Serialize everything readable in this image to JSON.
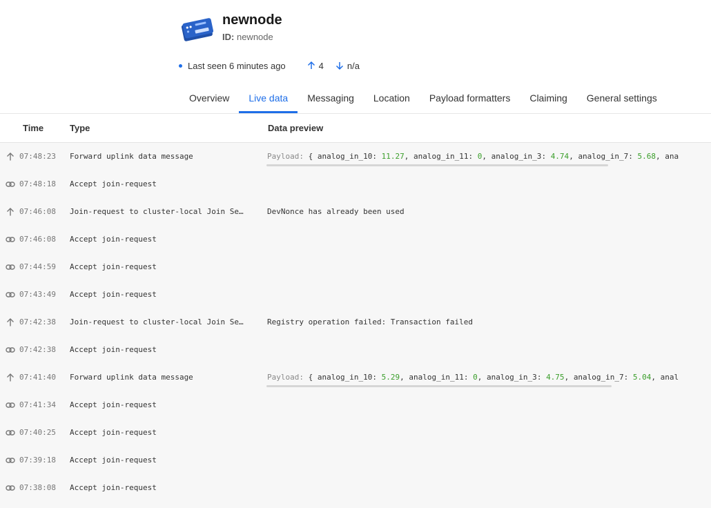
{
  "device": {
    "name": "newnode",
    "id_label": "ID:",
    "id_value": "newnode",
    "last_seen": "Last seen 6 minutes ago",
    "uplink_count": "4",
    "downlink_count": "n/a"
  },
  "tabs": [
    {
      "label": "Overview",
      "active": false
    },
    {
      "label": "Live data",
      "active": true
    },
    {
      "label": "Messaging",
      "active": false
    },
    {
      "label": "Location",
      "active": false
    },
    {
      "label": "Payload formatters",
      "active": false
    },
    {
      "label": "Claiming",
      "active": false
    },
    {
      "label": "General settings",
      "active": false
    }
  ],
  "table": {
    "headers": {
      "time": "Time",
      "type": "Type",
      "preview": "Data preview"
    },
    "rows": [
      {
        "icon": "uplink-arrow-icon",
        "time": "07:48:23",
        "type": "Forward uplink data message",
        "preview_kind": "payload",
        "payload": [
          [
            "analog_in_10",
            "11.27"
          ],
          [
            "analog_in_11",
            "0"
          ],
          [
            "analog_in_3",
            "4.74"
          ],
          [
            "analog_in_7",
            "5.68"
          ],
          [
            "ana",
            ""
          ]
        ]
      },
      {
        "icon": "link-icon",
        "time": "07:48:18",
        "type": "Accept join-request",
        "preview_kind": "none"
      },
      {
        "icon": "uplink-arrow-icon",
        "time": "07:46:08",
        "type": "Join-request to cluster-local Join Se…",
        "preview_kind": "text",
        "preview": "DevNonce has already been used"
      },
      {
        "icon": "link-icon",
        "time": "07:46:08",
        "type": "Accept join-request",
        "preview_kind": "none"
      },
      {
        "icon": "link-icon",
        "time": "07:44:59",
        "type": "Accept join-request",
        "preview_kind": "none"
      },
      {
        "icon": "link-icon",
        "time": "07:43:49",
        "type": "Accept join-request",
        "preview_kind": "none"
      },
      {
        "icon": "uplink-arrow-icon",
        "time": "07:42:38",
        "type": "Join-request to cluster-local Join Se…",
        "preview_kind": "text",
        "preview": "Registry operation failed: Transaction failed"
      },
      {
        "icon": "link-icon",
        "time": "07:42:38",
        "type": "Accept join-request",
        "preview_kind": "none"
      },
      {
        "icon": "uplink-arrow-icon",
        "time": "07:41:40",
        "type": "Forward uplink data message",
        "preview_kind": "payload",
        "payload": [
          [
            "analog_in_10",
            "5.29"
          ],
          [
            "analog_in_11",
            "0"
          ],
          [
            "analog_in_3",
            "4.75"
          ],
          [
            "analog_in_7",
            "5.04"
          ],
          [
            "anal",
            ""
          ]
        ]
      },
      {
        "icon": "link-icon",
        "time": "07:41:34",
        "type": "Accept join-request",
        "preview_kind": "none"
      },
      {
        "icon": "link-icon",
        "time": "07:40:25",
        "type": "Accept join-request",
        "preview_kind": "none"
      },
      {
        "icon": "link-icon",
        "time": "07:39:18",
        "type": "Accept join-request",
        "preview_kind": "none"
      },
      {
        "icon": "link-icon",
        "time": "07:38:08",
        "type": "Accept join-request",
        "preview_kind": "none"
      }
    ],
    "payload_label": "Payload:"
  },
  "colors": {
    "accent": "#1e6ee8",
    "number": "#3a9e2a"
  }
}
